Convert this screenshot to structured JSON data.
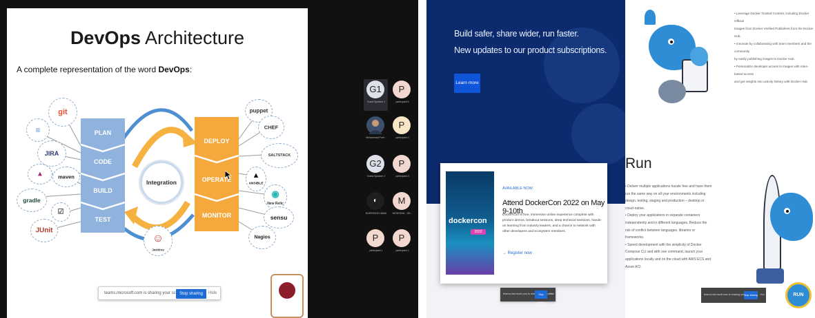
{
  "teams": {
    "slide": {
      "title_bold": "DevOps",
      "title_rest": " Architecture",
      "subtitle_prefix": "A complete representation of the word ",
      "subtitle_bold": "DevOps",
      "subtitle_suffix": ":",
      "dev_stages": [
        "PLAN",
        "CODE",
        "BUILD",
        "TEST"
      ],
      "ops_stages": [
        "DEPLOY",
        "OPERATE",
        "MONITOR"
      ],
      "hub_label": "Integration",
      "dev_tools": [
        "git",
        "JIRA",
        "maven",
        "gradle",
        "JUnit"
      ],
      "ops_tools": [
        "puppet",
        "CHEF",
        "SALTSTACK",
        "ANSIBLE",
        "New Relic",
        "sensu",
        "Nagios"
      ],
      "hub_tool": "Jenkins",
      "dev_color": "#8fb3dc",
      "ops_color": "#f5a93c"
    },
    "share_bar": {
      "text": "teams.microsoft.com is sharing your screen.",
      "stop_label": "Stop sharing",
      "hide_label": "Hide"
    },
    "participants": [
      {
        "initials": "G1",
        "name": "Guest Speaker 1",
        "style": "g"
      },
      {
        "initials": "P",
        "name": "participant.6",
        "style": "p"
      },
      {
        "initials": "",
        "name": "Muhammad Furh...",
        "style": "photo"
      },
      {
        "initials": "P",
        "name": "participant.4",
        "style": "y"
      },
      {
        "initials": "G2",
        "name": "Guest Speaker 2",
        "style": "g"
      },
      {
        "initials": "P",
        "name": "participant.3",
        "style": "p"
      },
      {
        "initials": "◐",
        "name": "BUEEDSON IMAM",
        "style": "dark"
      },
      {
        "initials": "M",
        "name": "MCSE0030 - SH...",
        "style": "p"
      },
      {
        "initials": "P",
        "name": "participant.1",
        "style": "p"
      },
      {
        "initials": "P",
        "name": "participant.2",
        "style": "p"
      }
    ]
  },
  "docker": {
    "hero_line1": "Build safer, share wider, run faster.",
    "hero_line2": "New updates to our product subscriptions.",
    "learn_more": "Learn more",
    "card": {
      "kicker": "AVAILABLE NOW",
      "title": "Attend DockerCon 2022 on May 9-10th",
      "body": "DockerCon is free, immersive online experience complete with product demos, breakout sessions, deep technical sessions, hands-on learning from industry leaders, and a chance to network with other developers and ecosystem members.",
      "link": "Register now",
      "image_brand": "dockercon",
      "image_badge": "2022"
    },
    "share_mid": {
      "text": "teams.microsoft.com is sharing your screen.",
      "stop_label": "Stop sharing",
      "hide_label": "Hide"
    },
    "top_bullets": [
      "• Leverage Docker Trusted Content, including Docker Official",
      "  Images from Docker Verified Publishers from the Docker Hub.",
      "• Innovate by collaborating with team members and the community",
      "  by easily publishing images to Docker Hub.",
      "• Personalize developer access to images with roles-based access",
      "  and get insights into activity history with Docker Hub."
    ],
    "run_title": "Run",
    "run_bullets": [
      "• Deliver multiple applications hassle free and have them",
      "  run the same way on all your environments including",
      "  design, testing, staging and production – desktop or",
      "  cloud-native.",
      "• Deploy your applications in separate containers",
      "  independently and in different languages. Reduce the",
      "  risk of conflict between languages, libraries or",
      "  frameworks.",
      "• Speed development with the simplicity of Docker",
      "  Compose CLI and with one command, launch your",
      "  applications locally and on the cloud with AWS ECS and",
      "  Azure ACI."
    ],
    "share_right": {
      "text": "teams.microsoft.com is sharing your screen.",
      "stop_label": "Stop sharing",
      "hide_label": "Hide"
    },
    "brand_navy": "#0b2b6e",
    "brand_blue": "#0f55d9",
    "whale_blue": "#2f8dd6"
  }
}
